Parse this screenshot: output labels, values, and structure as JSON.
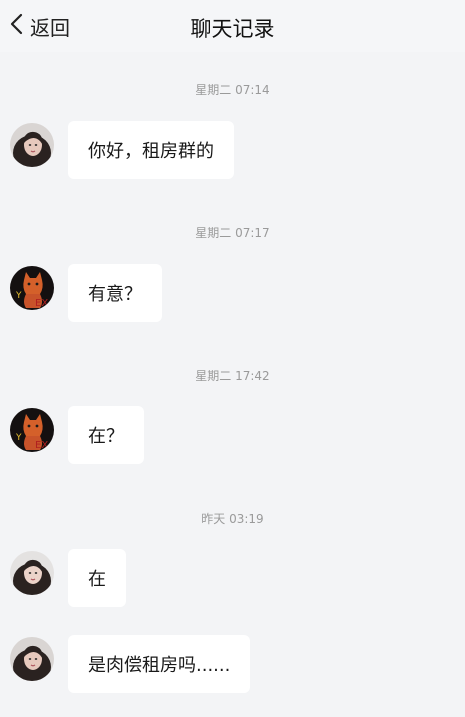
{
  "nav": {
    "back_label": "返回",
    "title": "聊天记录"
  },
  "messages": [
    {
      "time": "星期二 07:14",
      "sender": "woman-avatar",
      "text": "你好，租房群的"
    },
    {
      "time": "星期二 07:17",
      "sender": "cat-avatar",
      "text": "有意？"
    },
    {
      "time": "星期二 17:42",
      "sender": "cat-avatar",
      "text": "在？"
    },
    {
      "time": "昨天 03:19",
      "sender": "woman-avatar",
      "text": "在"
    },
    {
      "time": "",
      "sender": "woman-avatar",
      "text": "是肉偿租房吗......"
    }
  ],
  "colors": {
    "background": "#f3f4f6",
    "bubble": "#ffffff",
    "timestamp": "#9a9a9a"
  },
  "icons": {
    "back": "chevron-left-icon",
    "woman_avatar": "woman-avatar",
    "cat_avatar": "cat-avatar"
  }
}
